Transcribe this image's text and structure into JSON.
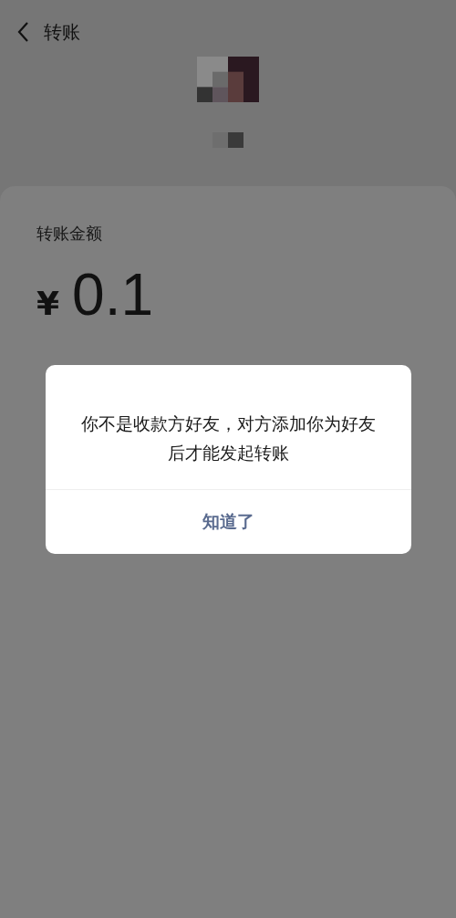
{
  "header": {
    "title": "转账"
  },
  "transfer": {
    "amount_label": "转账金额",
    "currency": "¥",
    "amount": "0.1"
  },
  "dialog": {
    "message": "你不是收款方好友，对方添加你为好友后才能发起转账",
    "button": "知道了"
  }
}
